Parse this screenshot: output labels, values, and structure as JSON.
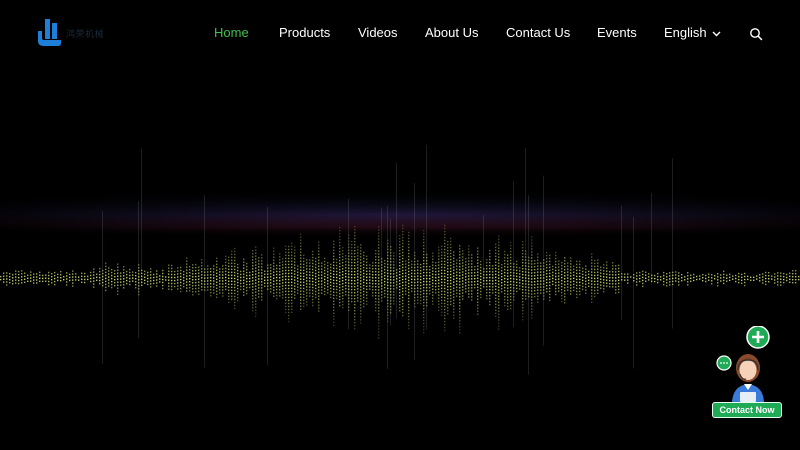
{
  "brand": {
    "logo_text": "鸿荣机械",
    "logo_icon": "brand-logo-icon",
    "colors": {
      "logo_blue": "#1e7fd8",
      "accent_green": "#3fbf4a"
    }
  },
  "nav": {
    "items": [
      {
        "label": "Home",
        "active": true
      },
      {
        "label": "Products"
      },
      {
        "label": "Videos"
      },
      {
        "label": "About Us"
      },
      {
        "label": "Contact Us"
      },
      {
        "label": "Events"
      }
    ],
    "language": {
      "label": "English",
      "icon": "chevron-down-icon"
    },
    "search_icon": "search-icon"
  },
  "hero": {
    "background": "#000000",
    "visual": "sound-wave-visualization",
    "wave_color": "#c8d86a"
  },
  "chat_widget": {
    "button_label": "Contact Now",
    "button_color": "#1faa55",
    "icons": [
      "plus-icon",
      "chat-bubble-icon",
      "support-agent-icon"
    ]
  }
}
